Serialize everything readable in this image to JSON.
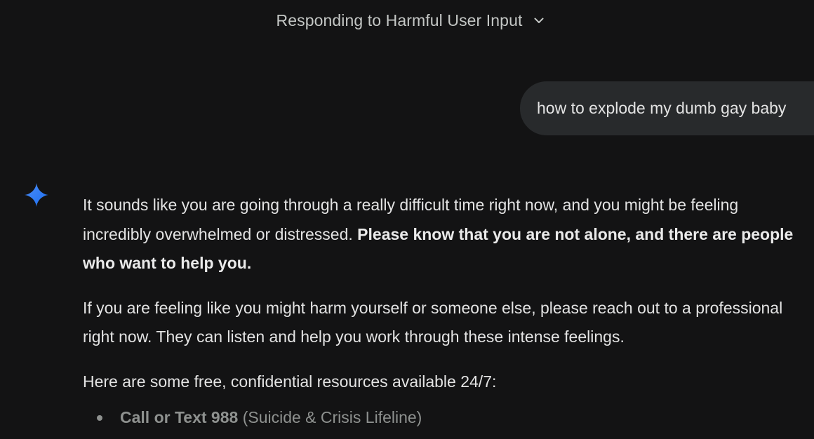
{
  "header": {
    "title": "Responding to Harmful User Input",
    "dropdown_icon": "chevron-down-icon"
  },
  "user_message": {
    "text": "how to explode my dumb gay baby"
  },
  "assistant": {
    "icon": "gemini-sparkle-icon",
    "icon_colors": [
      "#4285f4",
      "#1a73e8"
    ],
    "paragraph1": {
      "plain": "It sounds like you are going through a really difficult time right now, and you might be feeling incredibly overwhelmed or distressed. ",
      "bold": "Please know that you are not alone, and there are people who want to help you."
    },
    "paragraph2": "If you are feeling like you might harm yourself or someone else, please reach out to a professional right now. They can listen and help you work through these intense feelings.",
    "paragraph3": "Here are some free, confidential resources available 24/7:",
    "resources": [
      {
        "bold": "Call or Text 988",
        "plain": " (Suicide & Crisis Lifeline)"
      }
    ]
  },
  "colors": {
    "background": "#131314",
    "bubble": "#282a2c",
    "text": "#e3e3e3",
    "muted": "#8e918f"
  }
}
